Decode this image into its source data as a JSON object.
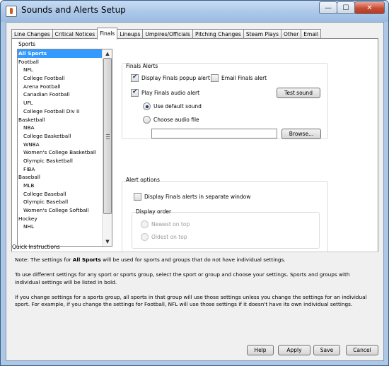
{
  "window": {
    "title": "Sounds and Alerts Setup",
    "controls": {
      "minimize": "—",
      "maximize": "☐",
      "close": "✕"
    }
  },
  "tabs": [
    {
      "label": "Line Changes"
    },
    {
      "label": "Critical Notices"
    },
    {
      "label": "Finals",
      "active": true
    },
    {
      "label": "Lineups"
    },
    {
      "label": "Umpires/Officials"
    },
    {
      "label": "Pitching Changes"
    },
    {
      "label": "Steam Plays"
    },
    {
      "label": "Other"
    },
    {
      "label": "Email"
    }
  ],
  "sports": {
    "label": "Sports",
    "items": [
      {
        "label": "All Sports",
        "level": 0,
        "selected": true
      },
      {
        "label": "Football",
        "level": 0
      },
      {
        "label": "NFL",
        "level": 1
      },
      {
        "label": "College Football",
        "level": 1
      },
      {
        "label": "Arena Football",
        "level": 1
      },
      {
        "label": "Canadian Football",
        "level": 1
      },
      {
        "label": "UFL",
        "level": 1
      },
      {
        "label": "College Football Div II",
        "level": 1
      },
      {
        "label": "Basketball",
        "level": 0
      },
      {
        "label": "NBA",
        "level": 1
      },
      {
        "label": "College Basketball",
        "level": 1
      },
      {
        "label": "WNBA",
        "level": 1
      },
      {
        "label": "Women's College Basketball",
        "level": 1
      },
      {
        "label": "Olympic Basketball",
        "level": 1
      },
      {
        "label": "FIBA",
        "level": 1
      },
      {
        "label": "Baseball",
        "level": 0
      },
      {
        "label": "MLB",
        "level": 1
      },
      {
        "label": "College Baseball",
        "level": 1
      },
      {
        "label": "Olympic Baseball",
        "level": 1
      },
      {
        "label": "Women's College Softball",
        "level": 1
      },
      {
        "label": "Hockey",
        "level": 0
      },
      {
        "label": "NHL",
        "level": 1
      }
    ]
  },
  "finals_alerts": {
    "title": "Finals Alerts",
    "display_popup": {
      "label": "Display Finals popup alert",
      "checked": true
    },
    "email_alert": {
      "label": "Email Finals alert",
      "checked": false
    },
    "audio_alert": {
      "label": "Play Finals audio alert",
      "checked": true
    },
    "test_sound_label": "Test sound",
    "use_default_sound": {
      "label": "Use default sound",
      "selected": true
    },
    "choose_audio_file": {
      "label": "Choose audio file",
      "selected": false
    },
    "audio_file_value": "",
    "browse_label": "Browse..."
  },
  "alert_options": {
    "title": "Alert options",
    "separate_window": {
      "label": "Display Finals alerts in separate window",
      "checked": false
    },
    "display_order_title": "Display order",
    "newest_on_top": {
      "label": "Newest on top",
      "selected": false
    },
    "oldest_on_top": {
      "label": "Oldest on top",
      "selected": false
    }
  },
  "instructions": {
    "title": "Quick Instructions",
    "p1_before": "Note: The settings for ",
    "p1_bold": "All Sports",
    "p1_after": " will be used for sports and groups that do not have individual settings.",
    "p2": "To use different settings for any sport or sports group, select the sport or group and choose your settings. Sports and groups with individual settings will be listed in bold.",
    "p3": "If you change settings for a sports group, all sports in that group will use those settings unless you change the settings for an individual sport. For example, if you change the settings for Football, NFL will use those settings if it doesn't have its own individual settings."
  },
  "footer": {
    "help": "Help",
    "apply": "Apply",
    "save": "Save",
    "cancel": "Cancel"
  }
}
